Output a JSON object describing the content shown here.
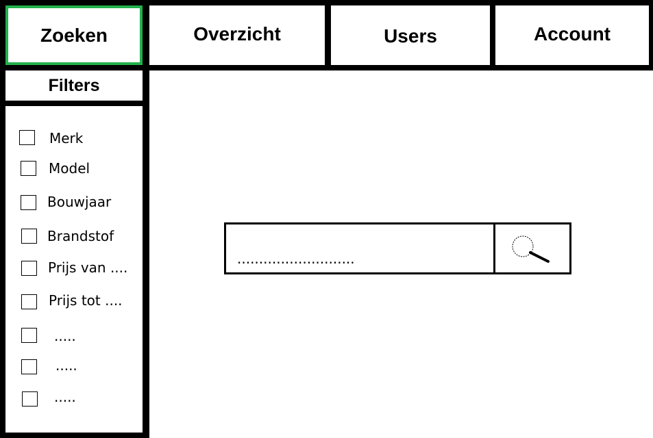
{
  "nav": {
    "tabs": [
      {
        "label": "Zoeken",
        "active": true
      },
      {
        "label": "Overzicht",
        "active": false
      },
      {
        "label": "Users",
        "active": false
      },
      {
        "label": "Account",
        "active": false
      }
    ],
    "active_color": "#22b14c"
  },
  "sidebar": {
    "title": "Filters",
    "filters": [
      {
        "label": "Merk",
        "checked": false
      },
      {
        "label": "Model",
        "checked": false
      },
      {
        "label": "Bouwjaar",
        "checked": false
      },
      {
        "label": "Brandstof",
        "checked": false
      },
      {
        "label": "Prijs van ....",
        "checked": false
      },
      {
        "label": "Prijs tot ....",
        "checked": false
      },
      {
        "label": ".....",
        "checked": false
      },
      {
        "label": ".....",
        "checked": false
      },
      {
        "label": ".....",
        "checked": false
      }
    ]
  },
  "search": {
    "placeholder": "...........................",
    "button_icon": "search-icon"
  }
}
